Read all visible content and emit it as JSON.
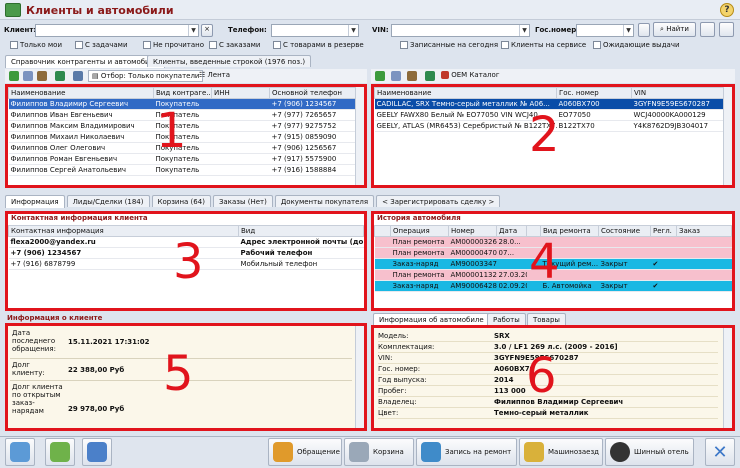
{
  "app": {
    "title": "Клиенты и автомобили",
    "help": "?"
  },
  "filters": {
    "client_label": "Клиент:",
    "phone_label": "Телефон:",
    "vin_label": "VIN:",
    "gos_label": "Гос.номер:",
    "find_label": "Найти",
    "checks": [
      "Только мои",
      "С задачами",
      "Не прочитано",
      "С заказами",
      "С товарами в резерве"
    ],
    "checks2": [
      "Записанные на сегодня",
      "Клиенты на сервисе",
      "Ожидающие выдачи"
    ]
  },
  "top_tabs": [
    "Справочник контрагенты и автомобили",
    "Клиенты, введенные строкой (1976 поз.)"
  ],
  "left_toolbar": {
    "filter": "Отбор: Только покупатели",
    "feed": "Лента"
  },
  "right_toolbar": {
    "oem": "OEM Каталог"
  },
  "clients": {
    "columns": [
      "Наименование",
      "Вид контраге...",
      "ИНН",
      "Основной телефон"
    ],
    "rows": [
      [
        "Филиппов Владимир Сергеевич",
        "Покупатель",
        "",
        "+7 (906) 1234567"
      ],
      [
        "Филиппов Иван Евгеньевич",
        "Покупатель",
        "",
        "+7 (977) 7265657"
      ],
      [
        "Филиппов Максим Владимирович",
        "Покупатель",
        "",
        "+7 (977) 9275752"
      ],
      [
        "Филиппов Михаил Николаевич",
        "Покупатель",
        "",
        "+7 (915) 0859090"
      ],
      [
        "Филиппов Олег Олегович",
        "Покупатель",
        "",
        "+7 (906) 1256567"
      ],
      [
        "Филиппов Роман Евгеньевич",
        "Покупатель",
        "",
        "+7 (917) 5575900"
      ],
      [
        "Филиппов Сергей Анатольевич",
        "Покупатель",
        "",
        "+7 (916) 1588884"
      ]
    ]
  },
  "cars": {
    "columns": [
      "Наименование",
      "Гос. номер",
      "VIN"
    ],
    "rows": [
      [
        "CADILLAC, SRX Темно-серый металлик № А06...",
        "А060ВХ700",
        "3GYFN9E59ES670287"
      ],
      [
        "GEELY FAWX80 Белый № ЕО77050 VIN WCJ40...",
        "ЕО77050",
        "WCJ40000KA000129"
      ],
      [
        "GEELY, ATLAS (MR6453) Серебристый № В122ТХ7...",
        "В122ТХ70",
        "Y4K8762D9JB304017"
      ]
    ]
  },
  "mid_tabs": [
    "Информация",
    "Лиды/Сделки (184)",
    "Корзина (64)",
    "Заказы (Нет)",
    "Документы покупателя",
    "< Зарегистрировать сделку >"
  ],
  "contact": {
    "title": "Контактная информация клиента",
    "columns": [
      "Контактная информация",
      "Вид"
    ],
    "rows": [
      [
        "flexa2000@yandex.ru",
        "Адрес электронной почты (до..."
      ],
      [
        "+7 (906) 1234567",
        "Рабочий телефон"
      ],
      [
        "+7 (916) 6878799",
        "Мобильный телефон"
      ]
    ]
  },
  "history": {
    "title": "История автомобиля",
    "columns": [
      "",
      "Операция",
      "Номер",
      "Дата",
      "",
      "Вид ремонта",
      "Состояние",
      "Регл.",
      "Заказ"
    ],
    "rows": [
      [
        "",
        "План ремонта",
        "АМ00000326",
        "28.0...",
        "",
        "",
        "",
        "",
        ""
      ],
      [
        "",
        "План ремонта",
        "АМ00000470",
        "07...",
        "",
        "",
        "",
        "",
        ""
      ],
      [
        "",
        "Заказ-наряд",
        "АМ90003347",
        "",
        "",
        "Текущий рем...",
        "Закрыт",
        "✔",
        ""
      ],
      [
        "",
        "План ремонта",
        "АМ00001132",
        "27.03.20...",
        "",
        "",
        "",
        "",
        ""
      ],
      [
        "",
        "Заказ-наряд",
        "АМ90006428",
        "02.09.2015",
        "",
        "Б. Автомойка",
        "Закрыт",
        "✔",
        ""
      ]
    ]
  },
  "client_info": {
    "title": "Информация о клиенте",
    "rows": [
      [
        "Дата последнего обращения:",
        "15.11.2021 17:31:02"
      ],
      [
        "Долг клиенту:",
        "22 388,00 Руб"
      ],
      [
        "Долг клиента по открытым заказ-нарядам",
        "29 978,00 Руб"
      ]
    ]
  },
  "car_tabs": [
    "Информация об автомобиле",
    "Работы",
    "Товары"
  ],
  "car_info": {
    "rows": [
      [
        "Модель:",
        "SRX"
      ],
      [
        "Комплектация:",
        "3.0 / LF1 269 л.с. (2009 - 2016]"
      ],
      [
        "VIN:",
        "3GYFN9E59ES670287"
      ],
      [
        "Гос. номер:",
        "А060ВХ70"
      ],
      [
        "Год выпуска:",
        "2014"
      ],
      [
        "Пробег:",
        "113 000"
      ],
      [
        "Владелец:",
        "Филиппов Владимир Сергеевич"
      ],
      [
        "Цвет:",
        "Темно-серый металлик"
      ]
    ]
  },
  "bottom": {
    "buttons": [
      "Обращение",
      "Корзина",
      "Запись на ремонт",
      "Машинозаезд",
      "Шинный отель"
    ]
  },
  "overlay_numbers": [
    "1",
    "2",
    "3",
    "4",
    "5",
    "6"
  ],
  "colors": {
    "title": "#8b1a1a",
    "overlay": "#e1141c",
    "selected": "#316ac5",
    "plan": "#f7c0cd",
    "order": "#19b8e3"
  }
}
